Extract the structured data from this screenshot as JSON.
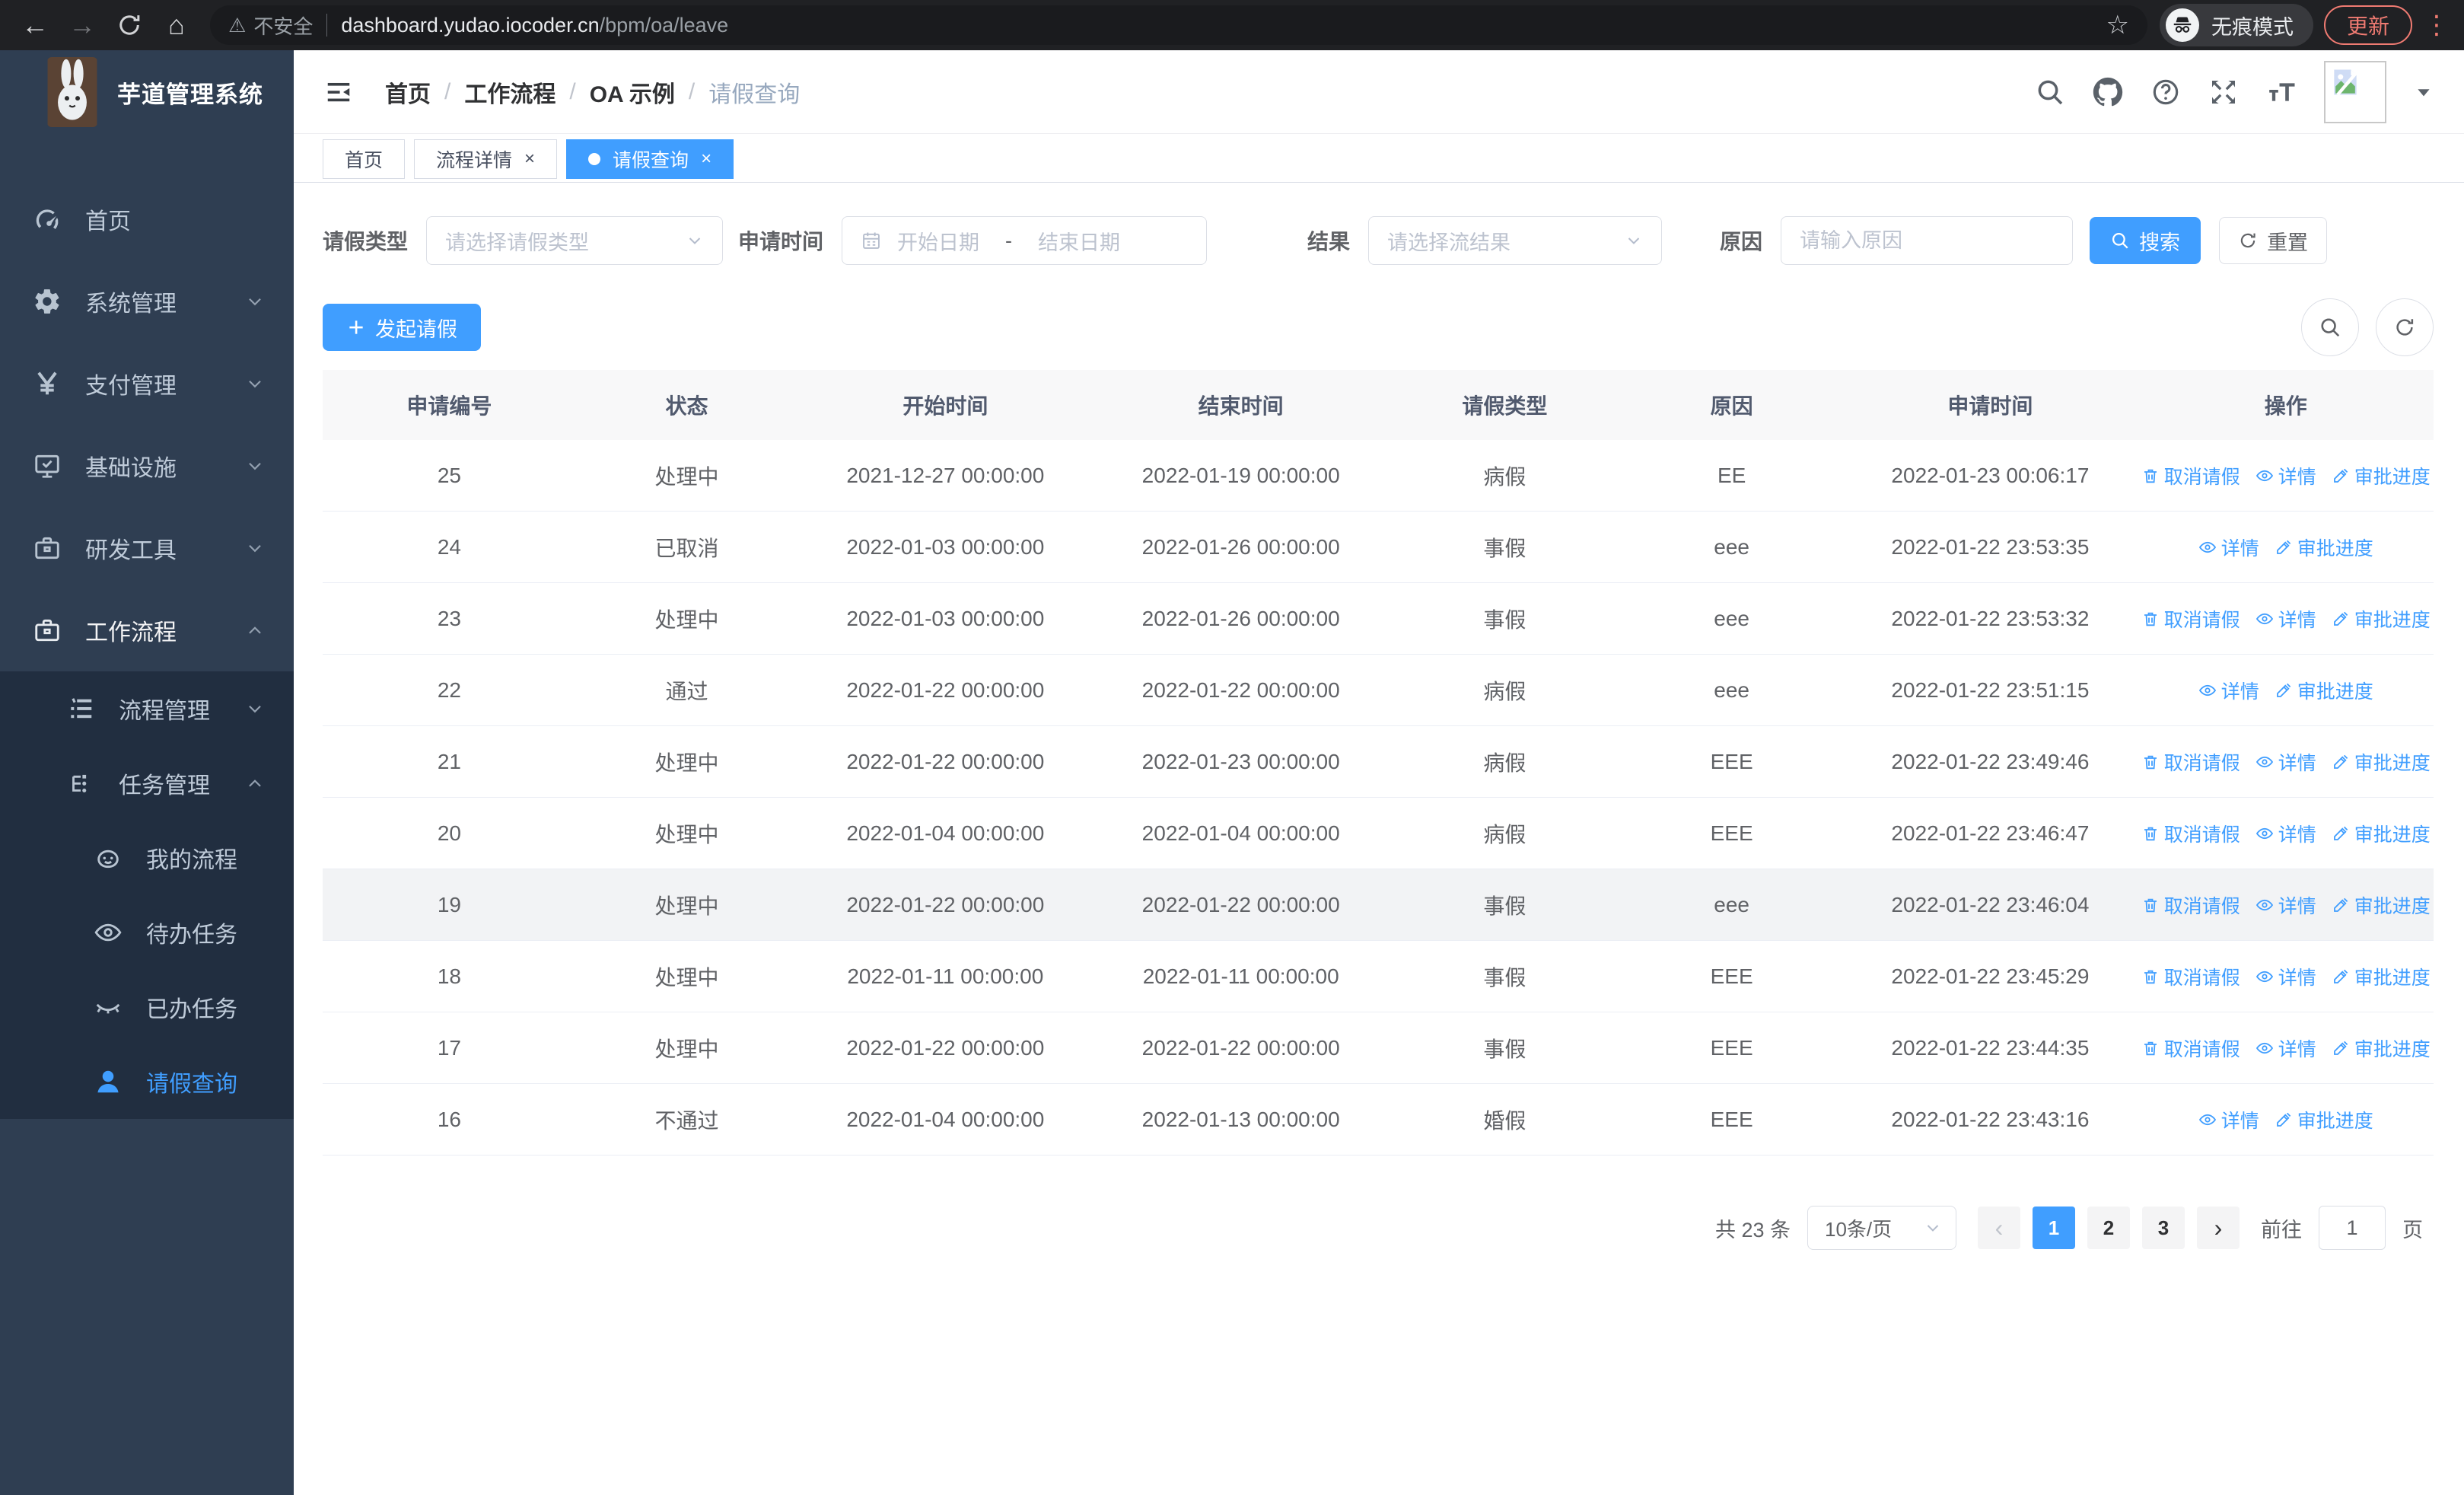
{
  "browser": {
    "security_warning": "不安全",
    "url_host": "dashboard.yudao.iocoder.cn",
    "url_path": "/bpm/oa/leave",
    "incognito_label": "无痕模式",
    "update_button": "更新"
  },
  "colors": {
    "primary": "#409eff",
    "sidebar_bg": "#2f3e52",
    "submenu_bg": "#212e40",
    "update_accent": "#f07b72",
    "breadcrumb_muted": "#97a8be"
  },
  "app": {
    "title": "芋道管理系统",
    "breadcrumb": [
      {
        "key": "home",
        "label": "首页"
      },
      {
        "key": "workflow",
        "label": "工作流程"
      },
      {
        "key": "oa-example",
        "label": "OA 示例"
      },
      {
        "key": "leave-query",
        "label": "请假查询"
      }
    ],
    "tabs": [
      {
        "key": "home",
        "label": "首页",
        "closable": false,
        "active": false
      },
      {
        "key": "process-detail",
        "label": "流程详情",
        "closable": true,
        "active": false
      },
      {
        "key": "leave-query",
        "label": "请假查询",
        "closable": true,
        "active": true
      }
    ]
  },
  "sidebar": {
    "items": [
      {
        "key": "home",
        "label": "首页",
        "icon": "gauge-icon",
        "level": 1,
        "arrow": null,
        "active": false,
        "expanded": false
      },
      {
        "key": "system-management",
        "label": "系统管理",
        "icon": "gear-icon",
        "level": 1,
        "arrow": "down",
        "active": false,
        "expanded": false
      },
      {
        "key": "payment-management",
        "label": "支付管理",
        "icon": "yen-icon",
        "level": 1,
        "arrow": "down",
        "active": false,
        "expanded": false
      },
      {
        "key": "infrastructure",
        "label": "基础设施",
        "icon": "monitor-icon",
        "level": 1,
        "arrow": "down",
        "active": false,
        "expanded": false
      },
      {
        "key": "dev-tools",
        "label": "研发工具",
        "icon": "toolbox-icon",
        "level": 1,
        "arrow": "down",
        "active": false,
        "expanded": false
      },
      {
        "key": "workflow",
        "label": "工作流程",
        "icon": "briefcase-icon",
        "level": 1,
        "arrow": "up",
        "active": false,
        "expanded": true
      },
      {
        "key": "process-management",
        "label": "流程管理",
        "icon": "list-icon",
        "level": 2,
        "arrow": "down",
        "active": false,
        "expanded": false
      },
      {
        "key": "task-management",
        "label": "任务管理",
        "icon": "tree-icon",
        "level": 2,
        "arrow": "up",
        "active": false,
        "expanded": true
      },
      {
        "key": "my-processes",
        "label": "我的流程",
        "icon": "robot-icon",
        "level": 3,
        "arrow": null,
        "active": false,
        "expanded": false
      },
      {
        "key": "todo-tasks",
        "label": "待办任务",
        "icon": "eye-icon",
        "level": 3,
        "arrow": null,
        "active": false,
        "expanded": false
      },
      {
        "key": "done-tasks",
        "label": "已办任务",
        "icon": "eye-closed-icon",
        "level": 3,
        "arrow": null,
        "active": false,
        "expanded": false
      },
      {
        "key": "leave-query",
        "label": "请假查询",
        "icon": "user-icon",
        "level": 3,
        "arrow": null,
        "active": true,
        "expanded": false
      }
    ]
  },
  "filters": {
    "leave_type": {
      "label": "请假类型",
      "placeholder": "请选择请假类型"
    },
    "apply_time": {
      "label": "申请时间",
      "start_placeholder": "开始日期",
      "separator": "-",
      "end_placeholder": "结束日期"
    },
    "result": {
      "label": "结果",
      "placeholder": "请选择流结果"
    },
    "reason": {
      "label": "原因",
      "placeholder": "请输入原因"
    },
    "search_button": "搜索",
    "reset_button": "重置"
  },
  "toolbar": {
    "create_button": "发起请假"
  },
  "table": {
    "headers": [
      "申请编号",
      "状态",
      "开始时间",
      "结束时间",
      "请假类型",
      "原因",
      "申请时间",
      "操作"
    ],
    "action_labels": {
      "cancel": "取消请假",
      "detail": "详情",
      "progress": "审批进度"
    },
    "rows": [
      {
        "id": "25",
        "status": "处理中",
        "start": "2021-12-27 00:00:00",
        "end": "2022-01-19 00:00:00",
        "type": "病假",
        "reason": "EE",
        "applied": "2022-01-23 00:06:17",
        "actions": [
          "cancel",
          "detail",
          "progress"
        ],
        "hover": false
      },
      {
        "id": "24",
        "status": "已取消",
        "start": "2022-01-03 00:00:00",
        "end": "2022-01-26 00:00:00",
        "type": "事假",
        "reason": "eee",
        "applied": "2022-01-22 23:53:35",
        "actions": [
          "detail",
          "progress"
        ],
        "hover": false
      },
      {
        "id": "23",
        "status": "处理中",
        "start": "2022-01-03 00:00:00",
        "end": "2022-01-26 00:00:00",
        "type": "事假",
        "reason": "eee",
        "applied": "2022-01-22 23:53:32",
        "actions": [
          "cancel",
          "detail",
          "progress"
        ],
        "hover": false
      },
      {
        "id": "22",
        "status": "通过",
        "start": "2022-01-22 00:00:00",
        "end": "2022-01-22 00:00:00",
        "type": "病假",
        "reason": "eee",
        "applied": "2022-01-22 23:51:15",
        "actions": [
          "detail",
          "progress"
        ],
        "hover": false
      },
      {
        "id": "21",
        "status": "处理中",
        "start": "2022-01-22 00:00:00",
        "end": "2022-01-23 00:00:00",
        "type": "病假",
        "reason": "EEE",
        "applied": "2022-01-22 23:49:46",
        "actions": [
          "cancel",
          "detail",
          "progress"
        ],
        "hover": false
      },
      {
        "id": "20",
        "status": "处理中",
        "start": "2022-01-04 00:00:00",
        "end": "2022-01-04 00:00:00",
        "type": "病假",
        "reason": "EEE",
        "applied": "2022-01-22 23:46:47",
        "actions": [
          "cancel",
          "detail",
          "progress"
        ],
        "hover": false
      },
      {
        "id": "19",
        "status": "处理中",
        "start": "2022-01-22 00:00:00",
        "end": "2022-01-22 00:00:00",
        "type": "事假",
        "reason": "eee",
        "applied": "2022-01-22 23:46:04",
        "actions": [
          "cancel",
          "detail",
          "progress"
        ],
        "hover": true
      },
      {
        "id": "18",
        "status": "处理中",
        "start": "2022-01-11 00:00:00",
        "end": "2022-01-11 00:00:00",
        "type": "事假",
        "reason": "EEE",
        "applied": "2022-01-22 23:45:29",
        "actions": [
          "cancel",
          "detail",
          "progress"
        ],
        "hover": false
      },
      {
        "id": "17",
        "status": "处理中",
        "start": "2022-01-22 00:00:00",
        "end": "2022-01-22 00:00:00",
        "type": "事假",
        "reason": "EEE",
        "applied": "2022-01-22 23:44:35",
        "actions": [
          "cancel",
          "detail",
          "progress"
        ],
        "hover": false
      },
      {
        "id": "16",
        "status": "不通过",
        "start": "2022-01-04 00:00:00",
        "end": "2022-01-13 00:00:00",
        "type": "婚假",
        "reason": "EEE",
        "applied": "2022-01-22 23:43:16",
        "actions": [
          "detail",
          "progress"
        ],
        "hover": false
      }
    ]
  },
  "pagination": {
    "total_text": "共 23 条",
    "page_size": "10条/页",
    "pages": [
      {
        "label": "1",
        "active": true
      },
      {
        "label": "2",
        "active": false
      },
      {
        "label": "3",
        "active": false
      }
    ],
    "goto_label": "前往",
    "goto_value": "1",
    "goto_suffix": "页"
  }
}
